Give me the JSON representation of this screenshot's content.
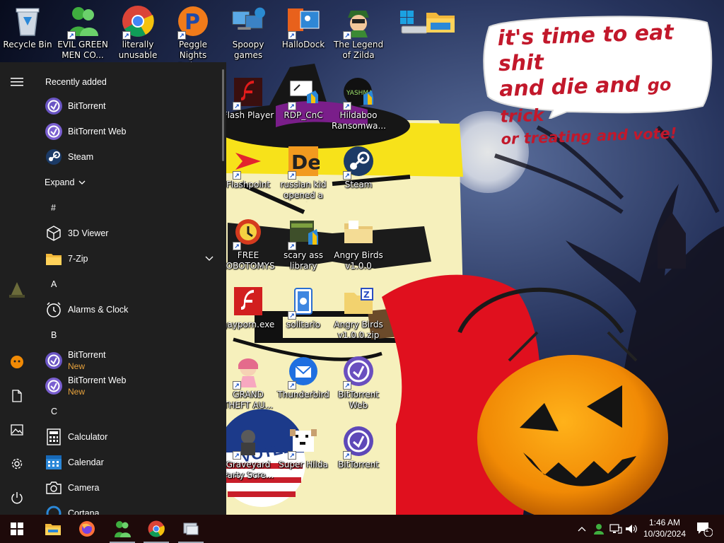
{
  "desktop": {
    "icons": [
      {
        "id": "recycle-bin",
        "label": "Recycle Bin"
      },
      {
        "id": "evil-green-men",
        "label": "EVIL GREEN MEN CO..."
      },
      {
        "id": "literally-unusable",
        "label": "literally unusable"
      },
      {
        "id": "peggle",
        "label": "Peggle Nights Deluxe"
      },
      {
        "id": "spoopy",
        "label": "Spoopy games"
      },
      {
        "id": "hallodock",
        "label": "HalloDock"
      },
      {
        "id": "zilda",
        "label": "The Legend of Zilda"
      },
      {
        "id": "flash-player",
        "label": "Flash Player"
      },
      {
        "id": "rdp",
        "label": "RDP_CnC"
      },
      {
        "id": "hildaboo",
        "label": "Hildaboo Ransomwa..."
      },
      {
        "id": "flashpoint",
        "label": "Flashpoint"
      },
      {
        "id": "russian-kid",
        "label": "russian kid opened a rat"
      },
      {
        "id": "steam",
        "label": "Steam"
      },
      {
        "id": "free-lobotomys",
        "label": "FREE LOBOTOMYS"
      },
      {
        "id": "scary-ass",
        "label": "scary ass library"
      },
      {
        "id": "angry-birds",
        "label": "Angry Birds v1.0.0"
      },
      {
        "id": "gayporn",
        "label": "gayporn.exe"
      },
      {
        "id": "solitario",
        "label": "solitario"
      },
      {
        "id": "angry-birds-zip",
        "label": "Angry Birds v1.0.0.zip"
      },
      {
        "id": "gta",
        "label": "GRAND THEFT AU..."
      },
      {
        "id": "thunderbird",
        "label": "Thunderbird"
      },
      {
        "id": "bittorrent-web",
        "label": "BitTorrent Web"
      },
      {
        "id": "graveyard",
        "label": "Graveyard Party Scre..."
      },
      {
        "id": "super-hilda",
        "label": "Super Hilda"
      },
      {
        "id": "bittorrent",
        "label": "BitTorrent"
      }
    ],
    "bubble": {
      "line1": "it's time to eat shit",
      "line2a": "and die and ",
      "line2b": "go trick",
      "line3": "or treating and vote!"
    },
    "bucket_text": "VOTED"
  },
  "start_menu": {
    "recently_added_label": "Recently added",
    "recent": [
      {
        "name": "BitTorrent",
        "icon": "bittorrent-icon"
      },
      {
        "name": "BitTorrent Web",
        "icon": "bittorrent-web-icon"
      },
      {
        "name": "Steam",
        "icon": "steam-icon"
      }
    ],
    "expand_label": "Expand",
    "sections": {
      "hash": "#",
      "a": "A",
      "b": "B",
      "c": "C"
    },
    "apps": {
      "viewer3d": "3D Viewer",
      "zip7": "7-Zip",
      "alarms": "Alarms & Clock",
      "bittorrent": "BitTorrent",
      "bittorrent_web": "BitTorrent Web",
      "new_badge": "New",
      "calculator": "Calculator",
      "calendar": "Calendar",
      "camera": "Camera",
      "cortana": "Cortana"
    }
  },
  "taskbar": {
    "time": "1:46 AM",
    "date": "10/30/2024",
    "notification_count": "1"
  },
  "colors": {
    "start_bg": "#1f1f1f",
    "taskbar_bg": "#1e0a0a",
    "new_badge": "#e8a33d",
    "bubble_text": "#c2182b"
  }
}
